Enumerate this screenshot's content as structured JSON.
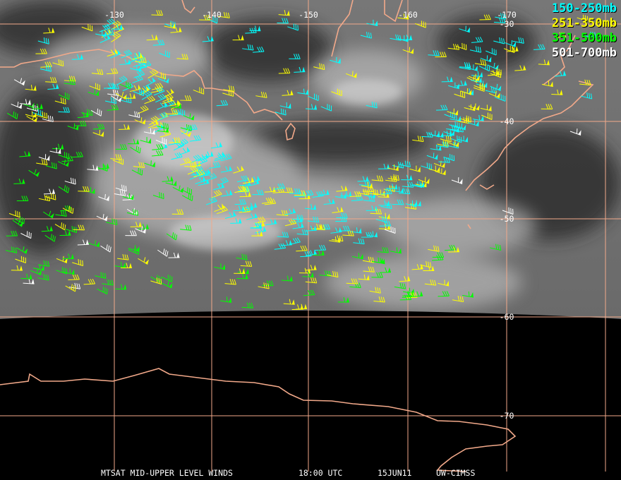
{
  "title": "MTSAT MID-UPPER LEVEL WINDS",
  "time": "18:00 UTC",
  "date": "15JUN11",
  "source": "UW-CIMSS",
  "longitude_labels": [
    "-130",
    "-140",
    "-150",
    "-160",
    "-170"
  ],
  "latitude_labels": [
    "-30",
    "-40",
    "-50",
    "-60",
    "-70"
  ],
  "legend": [
    {
      "label": "150-250mb",
      "color": "#00ffff"
    },
    {
      "label": "251-350mb",
      "color": "#ffff00"
    },
    {
      "label": "351-500mb",
      "color": "#00ff00"
    },
    {
      "label": "501-700mb",
      "color": "#ffffff"
    }
  ],
  "colors": {
    "grid": "#f2a98a",
    "coast": "#f2a98a",
    "background": "#000000"
  }
}
